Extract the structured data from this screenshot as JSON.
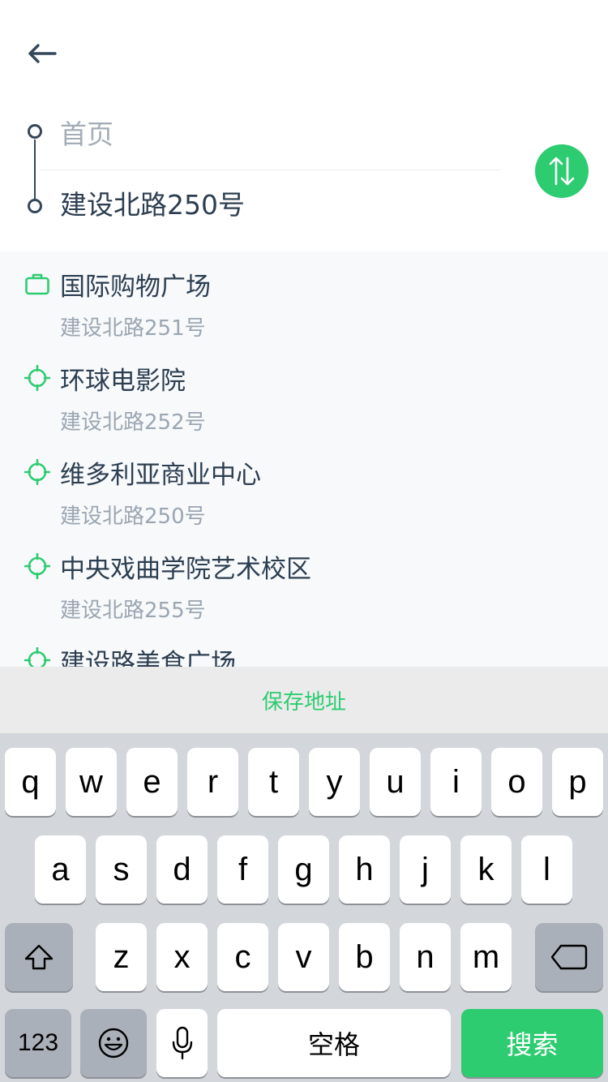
{
  "colors": {
    "accent": "#2ecc71",
    "text_primary": "#2c3e50",
    "text_secondary": "#9aa6b2",
    "list_background": "#f7f9fb",
    "keyboard_background": "#d3d6db"
  },
  "header": {
    "back_icon": "back-arrow-icon"
  },
  "route": {
    "start_label": "首页",
    "end_label": "建设北路250号",
    "swap_icon": "swap-vertical-icon"
  },
  "suggestions": [
    {
      "title": "国际购物广场",
      "address": "建设北路251号",
      "icon": "briefcase-icon"
    },
    {
      "title": "环球电影院",
      "address": "建设北路252号",
      "icon": "crosshair-icon"
    },
    {
      "title": "维多利亚商业中心",
      "address": "建设北路250号",
      "icon": "crosshair-icon"
    },
    {
      "title": "中央戏曲学院艺术校区",
      "address": "建设北路255号",
      "icon": "crosshair-icon"
    },
    {
      "title": "建设路美食广场",
      "address": "",
      "icon": "crosshair-icon"
    }
  ],
  "save_bar": {
    "label": "保存地址"
  },
  "keyboard": {
    "row1": [
      "q",
      "w",
      "e",
      "r",
      "t",
      "y",
      "u",
      "i",
      "o",
      "p"
    ],
    "row2": [
      "a",
      "s",
      "d",
      "f",
      "g",
      "h",
      "j",
      "k",
      "l"
    ],
    "row3": [
      "z",
      "x",
      "c",
      "v",
      "b",
      "n",
      "m"
    ],
    "numbers_label": "123",
    "space_label": "空格",
    "search_label": "搜索",
    "shift_icon": "shift-icon",
    "delete_icon": "delete-icon",
    "emoji_icon": "emoji-icon",
    "mic_icon": "microphone-icon"
  }
}
